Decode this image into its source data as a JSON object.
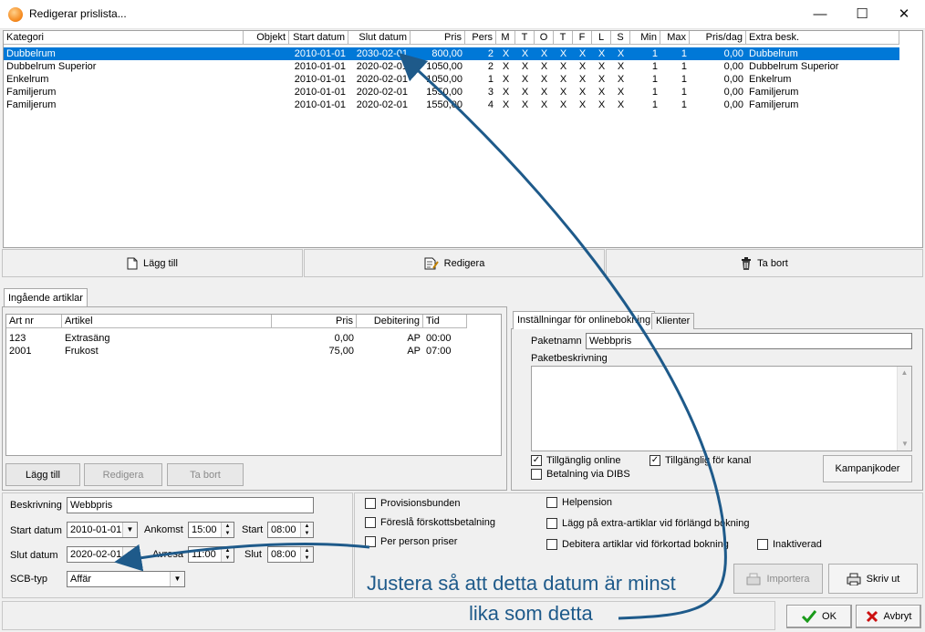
{
  "window": {
    "title": "Redigerar prislista...",
    "controls": {
      "minimize": "—",
      "maximize": "☐",
      "close": "✕"
    }
  },
  "price_table": {
    "columns": [
      "Kategori",
      "Objekt",
      "Start datum",
      "Slut datum",
      "Pris",
      "Pers",
      "M",
      "T",
      "O",
      "T",
      "F",
      "L",
      "S",
      "Min",
      "Max",
      "Pris/dag",
      "Extra besk."
    ],
    "rows": [
      {
        "kategori": "Dubbelrum",
        "objekt": "",
        "start": "2010-01-01",
        "slut": "2030-02-01",
        "pris": "800,00",
        "pers": "2",
        "m": "X",
        "t": "X",
        "o": "X",
        "t2": "X",
        "f": "X",
        "l": "X",
        "s": "X",
        "min": "1",
        "max": "1",
        "prisdag": "0,00",
        "extra": "Dubbelrum"
      },
      {
        "kategori": "Dubbelrum Superior",
        "objekt": "",
        "start": "2010-01-01",
        "slut": "2020-02-01",
        "pris": "1050,00",
        "pers": "2",
        "m": "X",
        "t": "X",
        "o": "X",
        "t2": "X",
        "f": "X",
        "l": "X",
        "s": "X",
        "min": "1",
        "max": "1",
        "prisdag": "0,00",
        "extra": "Dubbelrum Superior"
      },
      {
        "kategori": "Enkelrum",
        "objekt": "",
        "start": "2010-01-01",
        "slut": "2020-02-01",
        "pris": "1050,00",
        "pers": "1",
        "m": "X",
        "t": "X",
        "o": "X",
        "t2": "X",
        "f": "X",
        "l": "X",
        "s": "X",
        "min": "1",
        "max": "1",
        "prisdag": "0,00",
        "extra": "Enkelrum"
      },
      {
        "kategori": "Familjerum",
        "objekt": "",
        "start": "2010-01-01",
        "slut": "2020-02-01",
        "pris": "1550,00",
        "pers": "3",
        "m": "X",
        "t": "X",
        "o": "X",
        "t2": "X",
        "f": "X",
        "l": "X",
        "s": "X",
        "min": "1",
        "max": "1",
        "prisdag": "0,00",
        "extra": "Familjerum"
      },
      {
        "kategori": "Familjerum",
        "objekt": "",
        "start": "2010-01-01",
        "slut": "2020-02-01",
        "pris": "1550,00",
        "pers": "4",
        "m": "X",
        "t": "X",
        "o": "X",
        "t2": "X",
        "f": "X",
        "l": "X",
        "s": "X",
        "min": "1",
        "max": "1",
        "prisdag": "0,00",
        "extra": "Familjerum"
      }
    ]
  },
  "main_buttons": {
    "add": "Lägg till",
    "edit": "Redigera",
    "delete": "Ta bort"
  },
  "articles_tab": {
    "label": "Ingående artiklar"
  },
  "articles_table": {
    "columns": [
      "Art nr",
      "Artikel",
      "Pris",
      "Debitering",
      "Tid"
    ],
    "rows": [
      {
        "artnr": "123",
        "artikel": "Extrasäng",
        "pris": "0,00",
        "debitering": "AP",
        "tid": "00:00"
      },
      {
        "artnr": "2001",
        "artikel": "Frukost",
        "pris": "75,00",
        "debitering": "AP",
        "tid": "07:00"
      }
    ]
  },
  "article_buttons": {
    "add": "Lägg till",
    "edit": "Redigera",
    "delete": "Ta bort"
  },
  "online_tabs": {
    "settings": "Inställningar för onlinebokning",
    "clients": "Klienter"
  },
  "online": {
    "paketnamn_label": "Paketnamn",
    "paketnamn_value": "Webbpris",
    "paketbeskrivning_label": "Paketbeskrivning",
    "available_online": "Tillgänglig online",
    "available_channel": "Tillgänglig för kanal",
    "dibs_payment": "Betalning via DIBS",
    "campaign_button": "Kampanjkoder"
  },
  "form": {
    "beskrivning_label": "Beskrivning",
    "beskrivning_value": "Webbpris",
    "start_datum_label": "Start datum",
    "start_datum_value": "2010-01-01",
    "ankomst_label": "Ankomst",
    "ankomst_value": "15:00",
    "start_label": "Start",
    "start_value": "08:00",
    "slut_datum_label": "Slut datum",
    "slut_datum_value": "2020-02-01",
    "avresa_label": "Avresa",
    "avresa_value": "11:00",
    "slut_label": "Slut",
    "slut_value": "08:00",
    "scb_label": "SCB-typ",
    "scb_value": "Affär"
  },
  "options": {
    "provision": "Provisionsbunden",
    "forskott": "Föreslå förskottsbetalning",
    "per_person": "Per person priser",
    "helpension": "Helpension",
    "extra_articles": "Lägg på extra-artiklar vid förlängd bokning",
    "debit_articles": "Debitera artiklar vid förkortad bokning",
    "inactive": "Inaktiverad"
  },
  "action_buttons": {
    "import": "Importera",
    "print": "Skriv ut",
    "ok": "OK",
    "cancel": "Avbryt"
  },
  "annotation": {
    "line1": "Justera så att detta datum är minst",
    "line2": "lika som detta",
    "color": "#1e5a8a"
  }
}
